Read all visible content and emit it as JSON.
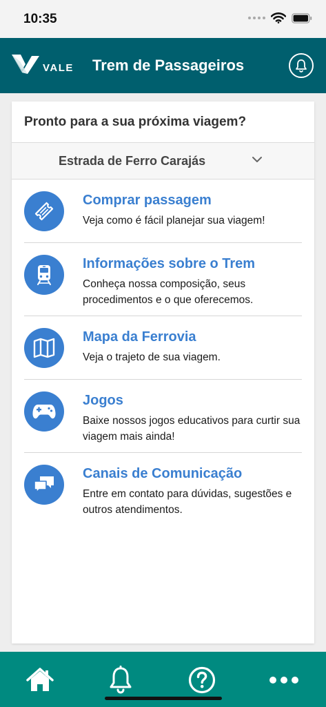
{
  "status_bar": {
    "time": "10:35"
  },
  "header": {
    "logo_text": "VALE",
    "title": "Trem de Passageiros"
  },
  "card": {
    "heading": "Pronto para a sua próxima viagem?",
    "route_selector": {
      "selected": "Estrada de Ferro Carajás"
    }
  },
  "menu": {
    "items": [
      {
        "icon": "ticket-icon",
        "title": "Comprar passagem",
        "description": "Veja como é fácil planejar sua viagem!"
      },
      {
        "icon": "train-icon",
        "title": "Informações sobre o Trem",
        "description": "Conheça nossa composição, seus procedimentos e o que oferecemos."
      },
      {
        "icon": "map-icon",
        "title": "Mapa da Ferrovia",
        "description": "Veja o trajeto de sua viagem."
      },
      {
        "icon": "gamepad-icon",
        "title": "Jogos",
        "description": "Baixe nossos jogos educativos para curtir sua viagem mais ainda!"
      },
      {
        "icon": "chat-icon",
        "title": "Canais de Comunicação",
        "description": "Entre em contato para dúvidas, sugestões e outros atendimentos."
      }
    ]
  },
  "bottom_nav": {
    "items": [
      {
        "icon": "home-icon"
      },
      {
        "icon": "bell-icon"
      },
      {
        "icon": "help-icon"
      },
      {
        "icon": "more-icon"
      }
    ]
  },
  "colors": {
    "header": "#005f6e",
    "bottom_nav": "#008a80",
    "accent": "#3a7fd0"
  }
}
